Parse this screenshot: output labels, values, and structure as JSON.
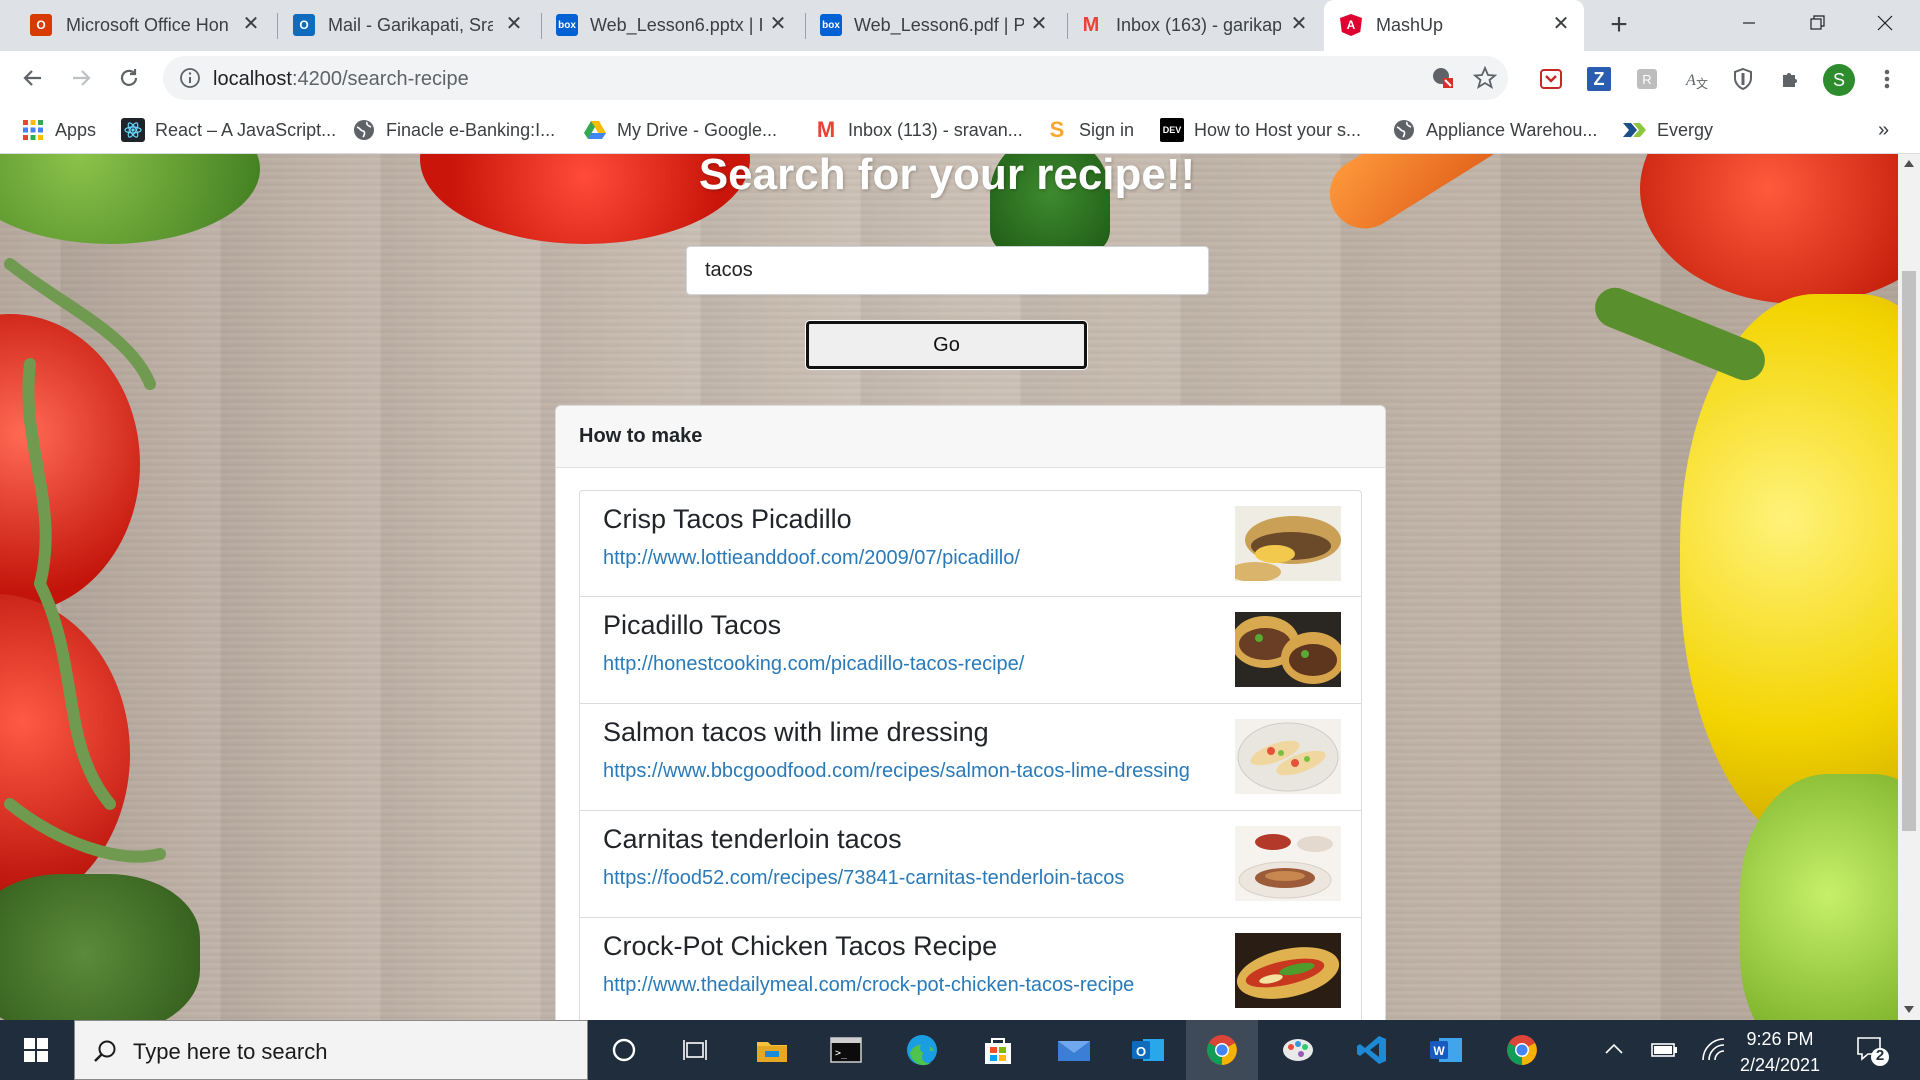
{
  "browser": {
    "tabs": [
      {
        "title": "Microsoft Office Hon",
        "icon": "office-icon",
        "color": "#d83b01"
      },
      {
        "title": "Mail - Garikapati, Sra",
        "icon": "outlook-icon",
        "color": "#0f6cbd"
      },
      {
        "title": "Web_Lesson6.pptx | I",
        "icon": "box-icon",
        "color": "#0061d5"
      },
      {
        "title": "Web_Lesson6.pdf | P",
        "icon": "box-icon",
        "color": "#0061d5"
      },
      {
        "title": "Inbox (163) - garikap",
        "icon": "gmail-icon",
        "color": "#ea4335"
      },
      {
        "title": "MashUp",
        "icon": "angular-icon",
        "color": "#dd0031",
        "active": true
      }
    ],
    "url_host": "localhost",
    "url_path": ":4200/search-recipe",
    "profile_initial": "S",
    "bookmarks": [
      {
        "label": "Apps",
        "icon": "apps-grid-icon"
      },
      {
        "label": "React – A JavaScript...",
        "icon": "react-icon"
      },
      {
        "label": "Finacle e-Banking:I...",
        "icon": "globe-icon"
      },
      {
        "label": "My Drive - Google...",
        "icon": "google-drive-icon"
      },
      {
        "label": "Inbox (113) - sravan...",
        "icon": "gmail-icon"
      },
      {
        "label": "Sign in",
        "icon": "sign-in-icon"
      },
      {
        "label": "How to Host your s...",
        "icon": "dev-icon",
        "badge": "DEV"
      },
      {
        "label": "Appliance Warehou...",
        "icon": "globe-icon"
      },
      {
        "label": "Evergy",
        "icon": "evergy-icon"
      }
    ],
    "bookmarks_overflow": "»"
  },
  "page": {
    "heading": "Search for your recipe!!",
    "search_value": "tacos",
    "go_label": "Go",
    "card_header": "How to make",
    "results": [
      {
        "title": "Crisp Tacos Picadillo",
        "url": "http://www.lottieanddoof.com/2009/07/picadillo/"
      },
      {
        "title": "Picadillo Tacos",
        "url": "http://honestcooking.com/picadillo-tacos-recipe/"
      },
      {
        "title": "Salmon tacos with lime dressing",
        "url": "https://www.bbcgoodfood.com/recipes/salmon-tacos-lime-dressing"
      },
      {
        "title": "Carnitas tenderloin tacos",
        "url": "https://food52.com/recipes/73841-carnitas-tenderloin-tacos"
      },
      {
        "title": "Crock-Pot Chicken Tacos Recipe",
        "url": "http://www.thedailymeal.com/crock-pot-chicken-tacos-recipe"
      }
    ]
  },
  "taskbar": {
    "search_placeholder": "Type here to search",
    "time": "9:26 PM",
    "date": "2/24/2021",
    "notification_count": "2",
    "apps": [
      "cortana-icon",
      "task-view-icon",
      "file-explorer-icon",
      "terminal-icon",
      "edge-icon",
      "store-icon",
      "mail-icon",
      "outlook-icon",
      "chrome-icon",
      "paint-icon",
      "vscode-icon",
      "word-icon",
      "chrome-icon"
    ]
  }
}
